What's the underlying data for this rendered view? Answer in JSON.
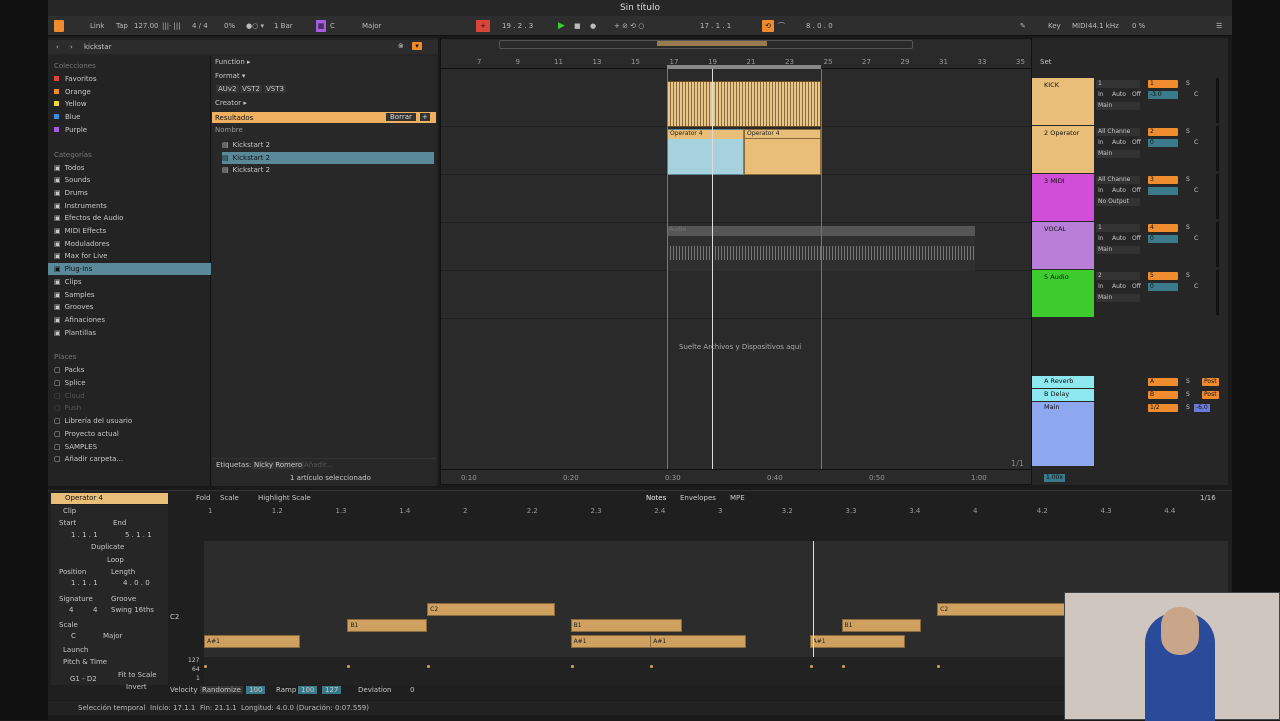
{
  "window_title": "Sin título",
  "toolbar": {
    "link": "Link",
    "tap": "Tap",
    "tempo": "127.00",
    "signature": "4 / 4",
    "swing": "0%",
    "quant": "1 Bar",
    "key_root": "C",
    "key_scale": "Major",
    "position": "19 . 2 . 3",
    "loop_start": "17 . 1 . 1",
    "loop_len": "8 . 0 . 0",
    "key_btn": "Key",
    "midi_btn": "MIDI",
    "sample_rate": "44.1 kHz",
    "cpu": "0 %"
  },
  "browser": {
    "search_value": "kickstar",
    "collections_header": "Colecciones",
    "collections": [
      {
        "label": "Favoritos",
        "color": "#e0443a"
      },
      {
        "label": "Orange",
        "color": "#f08c2e"
      },
      {
        "label": "Yellow",
        "color": "#e8d640"
      },
      {
        "label": "Blue",
        "color": "#3a8ee0"
      },
      {
        "label": "Purple",
        "color": "#a65ce0"
      }
    ],
    "categories_header": "Categorías",
    "categories": [
      "Todos",
      "Sounds",
      "Drums",
      "Instruments",
      "Efectos de Audio",
      "MIDI Effects",
      "Moduladores",
      "Max for Live",
      "Plug-Ins",
      "Clips",
      "Samples",
      "Grooves",
      "Afinaciones",
      "Plantillas"
    ],
    "places_header": "Places",
    "places": [
      "Packs",
      "Splice",
      "Cloud",
      "Push",
      "Librería del usuario",
      "Proyecto actual",
      "SAMPLES",
      "Añadir carpeta..."
    ],
    "filters": {
      "function": "Function ▸",
      "format": "Format ▾",
      "formats": [
        "AUv2",
        "VST2",
        "VST3"
      ],
      "creator": "Creator ▸"
    },
    "results_label": "Resultados",
    "clear_label": "Borrar",
    "name_header": "Nombre",
    "results": [
      "Kickstart 2",
      "Kickstart 2",
      "Kickstart 2"
    ],
    "tags_label": "Etiquetas:",
    "tag_value": "Nicky Romero",
    "tag_add": "Añadir...",
    "footer": "1 artículo seleccionado"
  },
  "arrangement": {
    "bar_numbers": [
      "7",
      "9",
      "11",
      "13",
      "15",
      "17",
      "19",
      "21",
      "23",
      "25",
      "27",
      "29",
      "31",
      "33",
      "35"
    ],
    "time_marks": [
      "0:10",
      "0:20",
      "0:30",
      "0:40",
      "0:50",
      "1:00"
    ],
    "drop_hint": "Suelte Archivos y Dispositivos aquí",
    "clip_labels": [
      "Operator 4",
      "Operator 4",
      "Audio"
    ],
    "zoom": "1/1"
  },
  "tracks": [
    {
      "name": "KICK",
      "color": "#e8be78",
      "num": "1",
      "input": "1",
      "io": "Main",
      "vol": "-3.0"
    },
    {
      "name": "2 Operator",
      "color": "#e8be78",
      "num": "2",
      "input": "All Channe",
      "io": "Main",
      "vol": "0"
    },
    {
      "name": "3 MIDI",
      "color": "#d14fd8",
      "num": "3",
      "input": "All Channe",
      "io": "No Output",
      "vol": ""
    },
    {
      "name": "VOCAL",
      "color": "#b87ed8",
      "num": "4",
      "input": "1",
      "io": "Main",
      "vol": "0"
    },
    {
      "name": "5 Audio",
      "color": "#3ccc2e",
      "num": "5",
      "input": "2",
      "io": "Main",
      "vol": "0"
    }
  ],
  "returns": [
    {
      "name": "A Reverb",
      "color": "#8ee8f0",
      "letter": "A"
    },
    {
      "name": "B Delay",
      "color": "#8ee8f0",
      "letter": "B"
    },
    {
      "name": "Main",
      "color": "#8ea8f0",
      "letter": "1/2"
    }
  ],
  "mixer_labels": {
    "set": "Set",
    "in": "In",
    "auto": "Auto",
    "off": "Off",
    "s": "S",
    "c": "C",
    "post": "Post",
    "master_vol": "-6.0",
    "tempo_mult": "1.00x",
    "w": "W",
    "h": "H"
  },
  "clip": {
    "name": "Operator 4",
    "section": "Clip",
    "start_label": "Start",
    "end_label": "End",
    "set": "Set",
    "start": "1 . 1 . 1",
    "end": "5 . 1 . 1",
    "duplicate": "Duplicate",
    "loop": "Loop",
    "position_label": "Position",
    "length_label": "Length",
    "position": "1 . 1 . 1",
    "length": "4 . 0 . 0",
    "signature_label": "Signature",
    "groove_label": "Groove",
    "sig_num": "4",
    "sig_den": "4",
    "groove": "Swing 16ths",
    "scale_label": "Scale",
    "scale_root": "C",
    "scale_name": "Major",
    "launch": "Launch",
    "pitch": "Pitch & Time",
    "range": "G1 - D2",
    "fit": "Fit to Scale",
    "invert": "Invert"
  },
  "editor": {
    "fold": "Fold",
    "scale": "Scale",
    "highlight": "Highlight Scale",
    "tabs": [
      "Notes",
      "Envelopes",
      "MPE"
    ],
    "grid": "1/16",
    "ruler": [
      "1",
      "1.2",
      "1.3",
      "1.4",
      "2",
      "2.2",
      "2.3",
      "2.4",
      "3",
      "3.2",
      "3.3",
      "3.4",
      "4",
      "4.2",
      "4.3",
      "4.4"
    ],
    "key_label": "C2",
    "vel_ticks": [
      "127",
      "64",
      "1"
    ],
    "velocity": "Velocity",
    "randomize": "Randomize",
    "rand_val": "100",
    "ramp": "Ramp",
    "ramp_a": "100",
    "ramp_b": "127",
    "deviation": "Deviation",
    "dev_val": "0"
  },
  "notes": [
    {
      "pitch": "C2",
      "start": 1.875,
      "len": 0.5
    },
    {
      "pitch": "C2",
      "start": 3.875,
      "len": 0.5
    },
    {
      "pitch": "B1",
      "start": 1.5625,
      "len": 0.3125
    },
    {
      "pitch": "B1",
      "start": 2.4375,
      "len": 0.4375
    },
    {
      "pitch": "B1",
      "start": 3.5,
      "len": 0.3125
    },
    {
      "pitch": "A#1",
      "start": 1.0,
      "len": 0.375
    },
    {
      "pitch": "A#1",
      "start": 2.4375,
      "len": 0.375
    },
    {
      "pitch": "A#1",
      "start": 2.75,
      "len": 0.375
    },
    {
      "pitch": "A#1",
      "start": 3.375,
      "len": 0.375
    }
  ],
  "status": {
    "mode": "Selección temporal",
    "start": "Inicio: 17.1.1",
    "end": "Fin: 21.1.1",
    "length": "Longitud: 4.0.0 (Duración: 0:07.559)"
  }
}
